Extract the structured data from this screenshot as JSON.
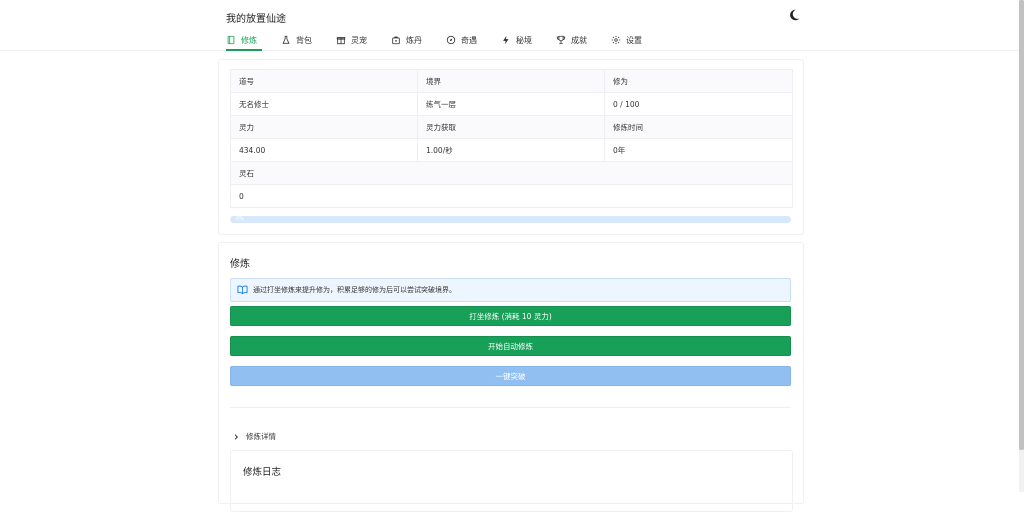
{
  "app": {
    "title": "我的放置仙途"
  },
  "nav": {
    "items": [
      {
        "label": "修炼",
        "icon": "book-icon"
      },
      {
        "label": "背包",
        "icon": "flask-icon"
      },
      {
        "label": "灵宠",
        "icon": "gift-icon"
      },
      {
        "label": "炼丹",
        "icon": "bag-icon"
      },
      {
        "label": "奇遇",
        "icon": "compass-icon"
      },
      {
        "label": "秘境",
        "icon": "bolt-icon"
      },
      {
        "label": "成就",
        "icon": "trophy-icon"
      },
      {
        "label": "设置",
        "icon": "gear-icon"
      }
    ],
    "active_index": 0
  },
  "stats": {
    "headers_row1": [
      "道号",
      "境界",
      "修为"
    ],
    "values_row1": [
      "无名修士",
      "练气一层",
      "0 / 100"
    ],
    "headers_row2": [
      "灵力",
      "灵力获取",
      "修炼时间"
    ],
    "values_row2": [
      "434.00",
      "1.00/秒",
      "0年"
    ],
    "header_row3": "灵石",
    "value_row3": "0",
    "progress": {
      "percent": 0,
      "text": "0%"
    }
  },
  "cultivate": {
    "title": "修炼",
    "info": "通过打坐修炼来提升修为，积累足够的修为后可以尝试突破境界。",
    "meditate_button": "打坐修炼 (消耗 10 灵力)",
    "auto_button": "开始自动修炼",
    "breakthrough_button": "一键突破",
    "details_label": "修炼详情",
    "log_title": "修炼日志"
  },
  "colors": {
    "accent": "#18a058",
    "info_bg": "#edf5fe",
    "disabled_blue": "#91bff2"
  }
}
